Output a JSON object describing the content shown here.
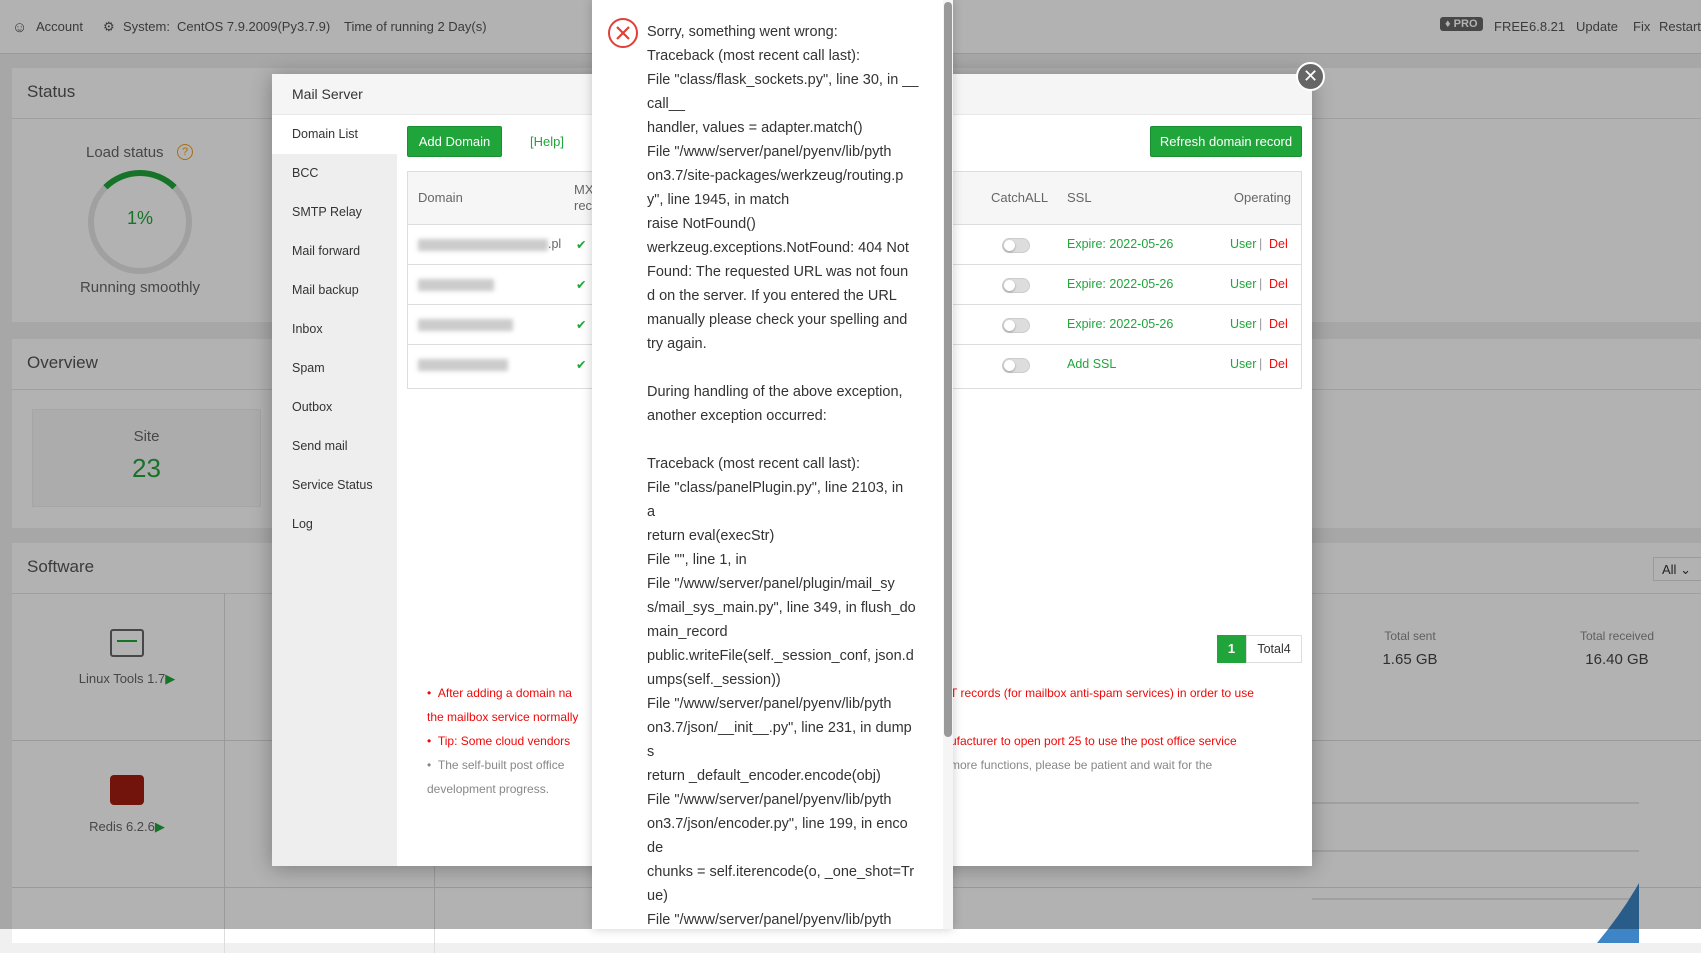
{
  "topbar": {
    "account": "Account",
    "system_label": "System:",
    "system": "CentOS 7.9.2009(Py3.7.9)",
    "uptime": "Time of running 2 Day(s)",
    "pro": "PRO",
    "free": "FREE",
    "version": "6.8.21",
    "update": "Update",
    "fix": "Fix",
    "restart": "Restart"
  },
  "status": {
    "title": "Status",
    "load_label": "Load status",
    "load_value": "1%",
    "load_percent": 1,
    "load_state": "Running smoothly"
  },
  "overview": {
    "title": "Overview",
    "site_label": "Site",
    "site_value": "23"
  },
  "software": {
    "title": "Software",
    "filter": "All",
    "items": [
      {
        "label": "Linux Tools 1.7"
      },
      {
        "label": "Redis 6.2.6"
      }
    ],
    "total_sent_label": "Total sent",
    "total_sent": "1.65 GB",
    "total_received_label": "Total received",
    "total_received": "16.40 GB"
  },
  "mail": {
    "title": "Mail Server",
    "sidebar": [
      "Domain List",
      "BCC",
      "SMTP Relay",
      "Mail forward",
      "Mail backup",
      "Inbox",
      "Spam",
      "Outbox",
      "Send mail",
      "Service Status",
      "Log"
    ],
    "add_domain": "Add Domain",
    "help": "[Help]",
    "refresh": "Refresh domain record",
    "columns": {
      "domain": "Domain",
      "mx": "MX rec",
      "catchall": "CatchALL",
      "ssl": "SSL",
      "operating": "Operating"
    },
    "rows": [
      {
        "domain_suffix": ".pl",
        "ssl": "Expire: 2022-05-26",
        "catchall": false
      },
      {
        "domain_suffix": "",
        "ssl": "Expire: 2022-05-26",
        "catchall": false
      },
      {
        "domain_suffix": "",
        "ssl": "Expire: 2022-05-26",
        "catchall": false
      },
      {
        "domain_suffix": "",
        "ssl": "Add SSL",
        "catchall": false
      }
    ],
    "user": "User",
    "sep": "|",
    "del": "Del",
    "page": "1",
    "total": "Total4",
    "notes": {
      "n1_left": "After adding a domain na",
      "n1_right": "T records (for mailbox anti-spam services) in order to use",
      "n1_cont": "the mailbox service normally",
      "n2_left": "Tip: Some cloud vendors",
      "n2_right": "ufacturer to open port 25 to use the post office service",
      "n3_left": "The self-built post office",
      "n3_right": "more functions, please be patient and wait for the",
      "n3_cont": "development progress."
    }
  },
  "error": {
    "icon": "error-circle-x-icon",
    "lines": [
      "Sorry, something went wrong:",
      "Traceback (most recent call last):",
      "File \"class/flask_sockets.py\", line 30, in __",
      "call__",
      "handler, values = adapter.match()",
      "File \"/www/server/panel/pyenv/lib/pyth",
      "on3.7/site-packages/werkzeug/routing.p",
      "y\", line 1945, in match",
      "raise NotFound()",
      "werkzeug.exceptions.NotFound: 404 Not",
      "Found: The requested URL was not foun",
      "d on the server. If you entered the URL",
      "manually please check your spelling and",
      "try again.",
      "",
      "During handling of the above exception,",
      "another exception occurred:",
      "",
      "Traceback (most recent call last):",
      "File \"class/panelPlugin.py\", line 2103, in",
      "a",
      "return eval(execStr)",
      "File \"\", line 1, in",
      "File \"/www/server/panel/plugin/mail_sy",
      "s/mail_sys_main.py\", line 349, in flush_do",
      "main_record",
      "public.writeFile(self._session_conf, json.d",
      "umps(self._session))",
      "File \"/www/server/panel/pyenv/lib/pyth",
      "on3.7/json/__init__.py\", line 231, in dump",
      "s",
      "return _default_encoder.encode(obj)",
      "File \"/www/server/panel/pyenv/lib/pyth",
      "on3.7/json/encoder.py\", line 199, in enco",
      "de",
      "chunks = self.iterencode(o, _one_shot=Tr",
      "ue)",
      "File \"/www/server/panel/pyenv/lib/pyth"
    ]
  },
  "colors": {
    "accent": "#20a53a",
    "danger": "#ef0808"
  }
}
